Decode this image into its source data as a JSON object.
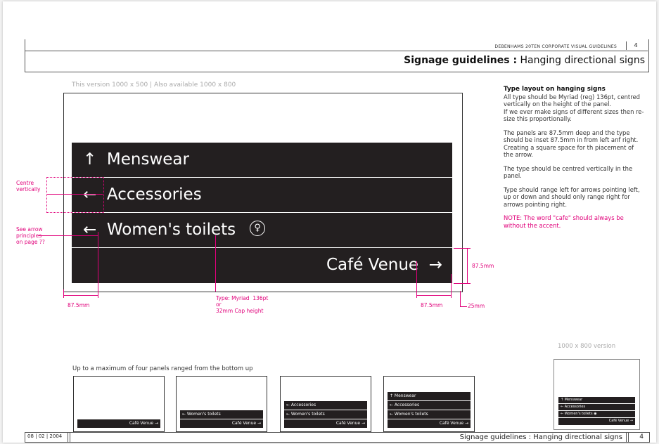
{
  "header": {
    "doc_title": "DEBENHAMS 20TEN CORPORATE VISUAL GUIDELINES",
    "page_number": "4",
    "section_bold": "Signage guidelines :",
    "section_rest": " Hanging directional signs"
  },
  "main_sign": {
    "version_note": "This version 1000 x 500  |  Also available 1000 x 800",
    "panels": [
      {
        "arrow": "↑",
        "label": "Menswear"
      },
      {
        "arrow": "←",
        "label": "Accessories"
      },
      {
        "arrow": "←",
        "label": "Women's toilets",
        "icon": "female-toilet-icon"
      },
      {
        "label": "Café Venue",
        "arrow": "→"
      }
    ],
    "toilet_glyph": "♀"
  },
  "annotations": {
    "centre": "Centre\nvertically",
    "arrow_principles": "See arrow\nprinciples\non page ??",
    "inset_left": "87.5mm",
    "type_note": "Type: Myriad  136pt\nor\n32mm Cap height",
    "inset_right": "87.5mm",
    "margin_right": "25mm",
    "panel_depth": "87.5mm"
  },
  "guidance": {
    "heading": "Type layout on hanging signs",
    "p1": "All type should be Myriad (reg) 136pt, centred vertically on the height of the panel.\nIf we ever make signs of different sizes then re-size this proportionally.",
    "p2": "The panels are 87.5mm deep and the type should be inset 87.5mm in from left anf right. Creating a square space for th piacement of the arrow.",
    "p3": "The type should be centred vertically in the panel.",
    "p4": "Type should range left for arrows pointing left, up or down and should only range right for arrows pointing right.",
    "note": "NOTE: The word \"cafe\" should always be without the accent."
  },
  "examples": {
    "caption": "Up to a maximum of four panels ranged from the bottom up",
    "menswear": "↑ Menswear",
    "accessories": "← Accessories",
    "toilets": "← Women's toilets",
    "cafe": "Café Venue →",
    "alt_version_label": "1000 x 800 version",
    "alt_toilets": "← Women's toilets  ◉"
  },
  "footer": {
    "date": "08 | 02 | 2004",
    "title": "Signage guidelines : Hanging directional signs",
    "page_number": "4"
  }
}
